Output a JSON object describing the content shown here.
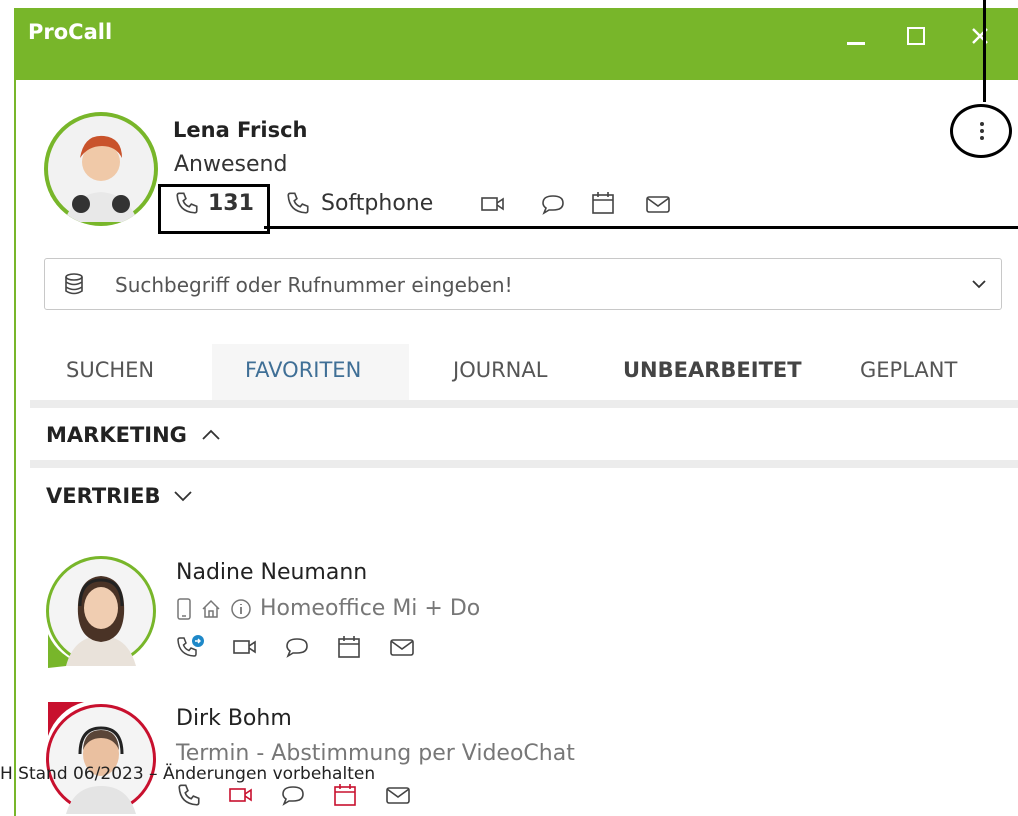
{
  "window": {
    "title": "ProCall",
    "controls": [
      "minimize",
      "maximize",
      "close"
    ],
    "accent_color": "#78b62a"
  },
  "profile": {
    "name": "Lena Frisch",
    "status": "Anwesend",
    "status_color": "#78b62a",
    "extension": "131",
    "phone_device": "Softphone",
    "actions": [
      "video-icon",
      "chat-icon",
      "calendar-icon",
      "mail-icon"
    ]
  },
  "search": {
    "placeholder": "Suchbegriff oder Rufnummer eingeben!"
  },
  "tabs": [
    {
      "label": "SUCHEN",
      "active": false
    },
    {
      "label": "FAVORITEN",
      "active": true
    },
    {
      "label": "JOURNAL",
      "active": false
    },
    {
      "label": "UNBEARBEITET",
      "active": false,
      "bold": true
    },
    {
      "label": "GEPLANT",
      "active": false
    }
  ],
  "groups": [
    {
      "name": "MARKETING",
      "expanded": true
    },
    {
      "name": "VERTRIEB",
      "expanded": false
    }
  ],
  "contacts": [
    {
      "name": "Nadine Neumann",
      "status": "Homeoffice Mi + Do",
      "presence_color": "#78b62a"
    },
    {
      "name": "Dirk Bohm",
      "status": "Termin - Abstimmung per VideoChat",
      "presence_color": "#c8102e"
    }
  ],
  "footer": {
    "text": "H Stand 06/2023 – Änderungen vorbehalten"
  }
}
